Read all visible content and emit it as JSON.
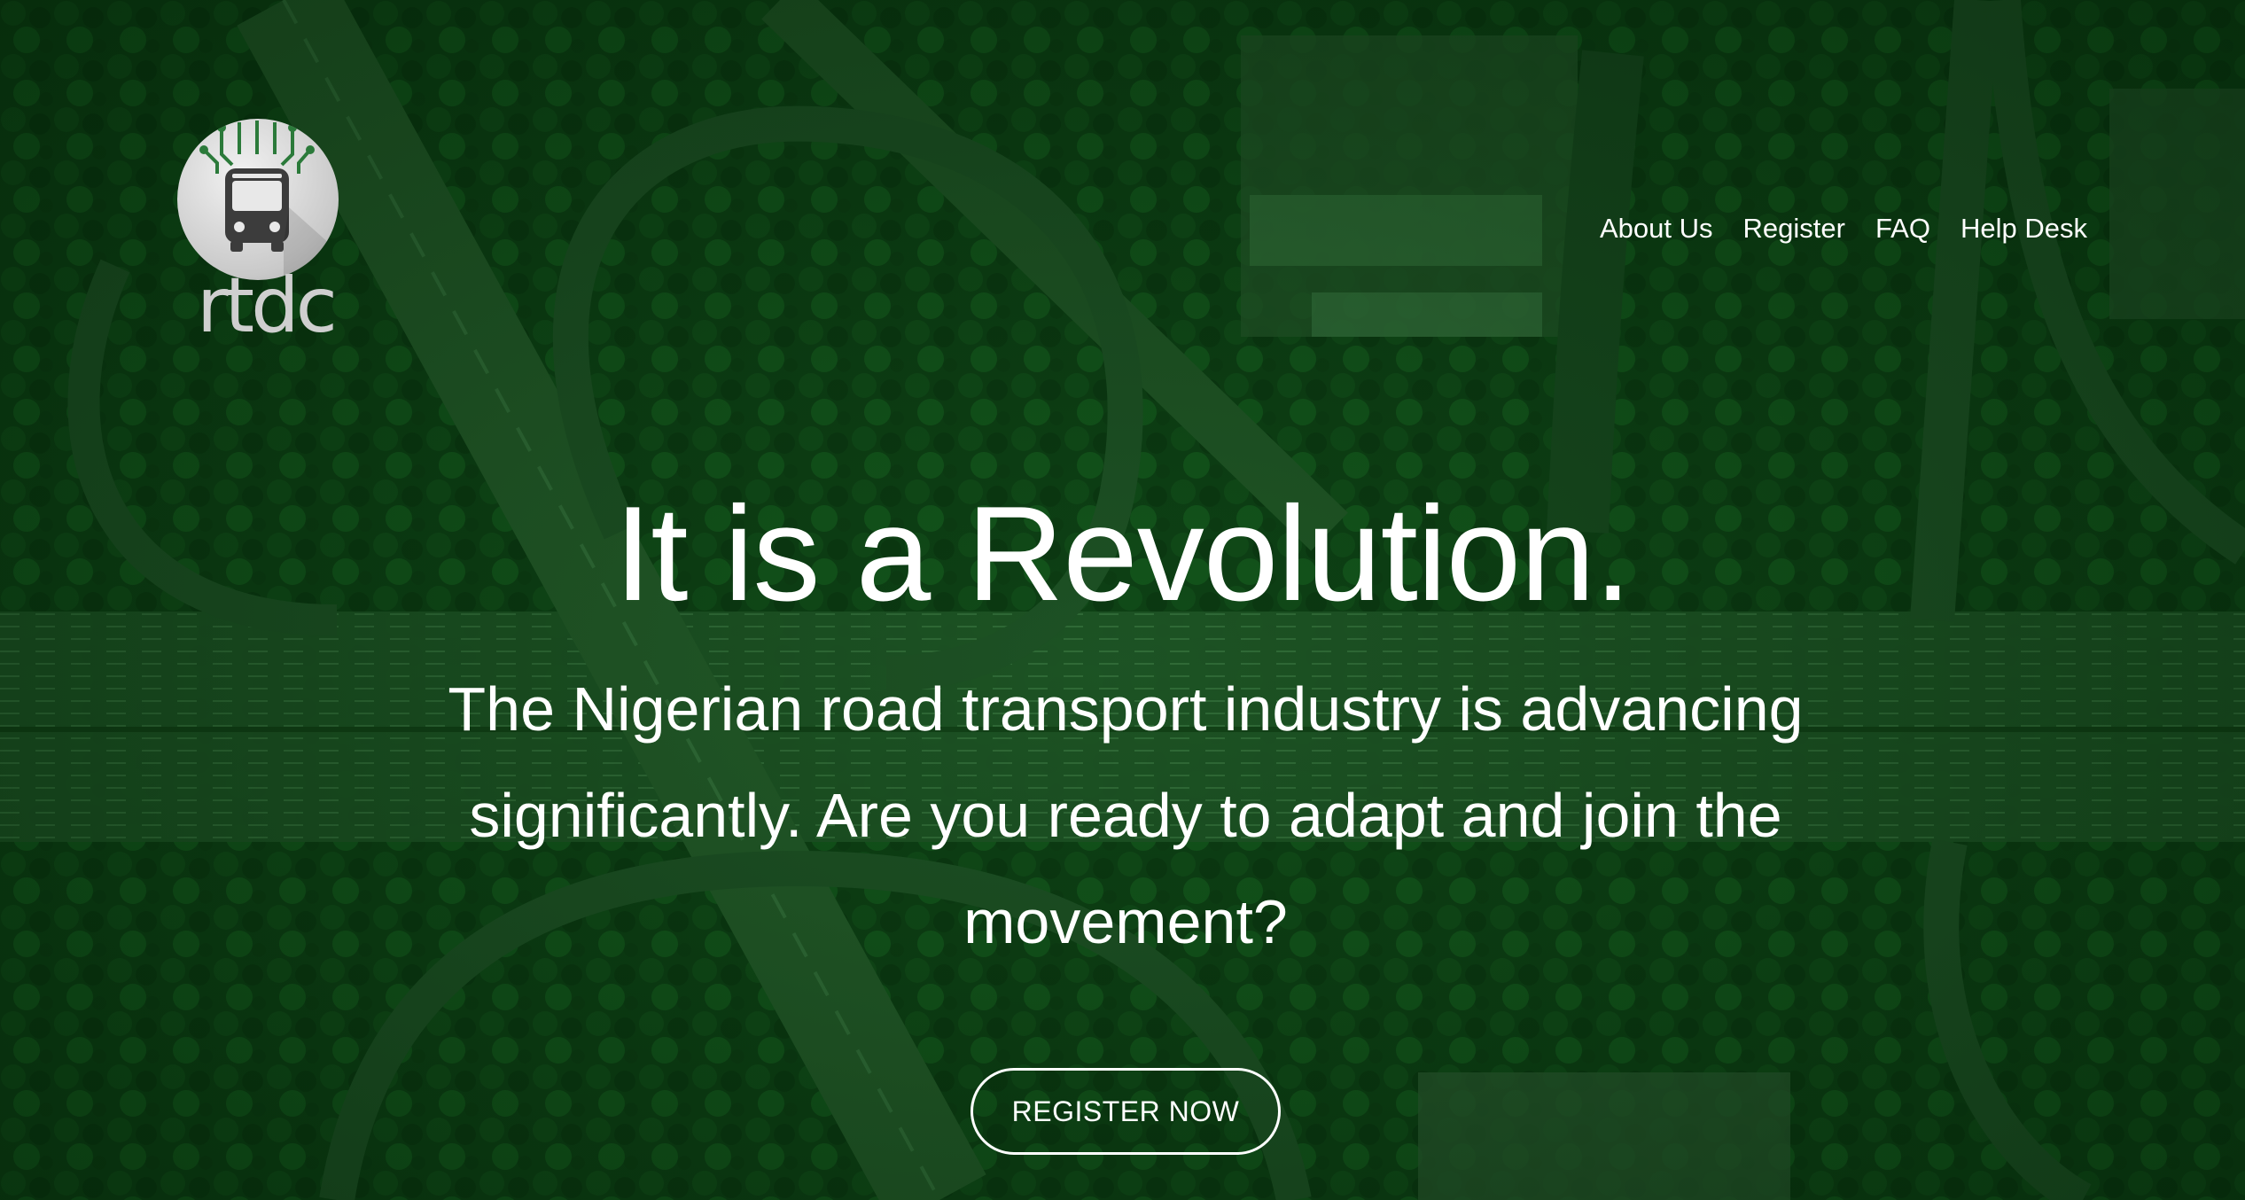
{
  "brand": {
    "logo_text": "rtdc",
    "logo_icon": "bus-circuit-icon"
  },
  "nav": {
    "items": [
      {
        "label": "About Us"
      },
      {
        "label": "Register"
      },
      {
        "label": "FAQ"
      },
      {
        "label": "Help Desk"
      }
    ]
  },
  "hero": {
    "headline": "It is a Revolution.",
    "subtext": "The Nigerian road transport industry is advancing significantly. Are you ready to adapt and join the movement?",
    "cta_label": "REGISTER NOW",
    "background": "aerial-highway-interchange-image"
  },
  "colors": {
    "overlay": "#0d4a18",
    "text": "#ffffff"
  }
}
